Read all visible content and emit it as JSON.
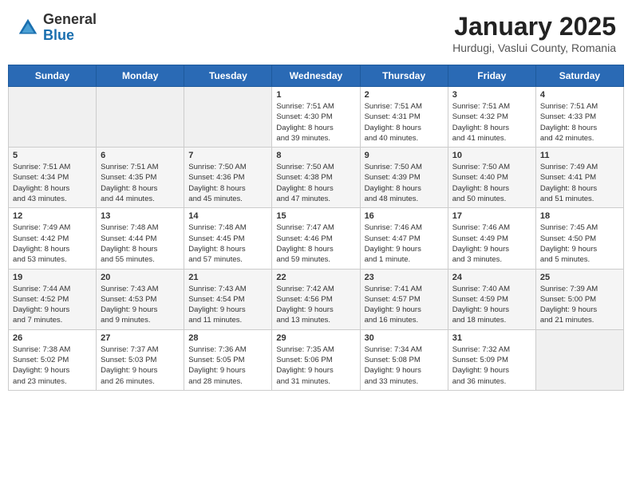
{
  "header": {
    "logo_general": "General",
    "logo_blue": "Blue",
    "title": "January 2025",
    "subtitle": "Hurdugi, Vaslui County, Romania"
  },
  "days_of_week": [
    "Sunday",
    "Monday",
    "Tuesday",
    "Wednesday",
    "Thursday",
    "Friday",
    "Saturday"
  ],
  "weeks": [
    [
      {
        "day": "",
        "info": ""
      },
      {
        "day": "",
        "info": ""
      },
      {
        "day": "",
        "info": ""
      },
      {
        "day": "1",
        "info": "Sunrise: 7:51 AM\nSunset: 4:30 PM\nDaylight: 8 hours\nand 39 minutes."
      },
      {
        "day": "2",
        "info": "Sunrise: 7:51 AM\nSunset: 4:31 PM\nDaylight: 8 hours\nand 40 minutes."
      },
      {
        "day": "3",
        "info": "Sunrise: 7:51 AM\nSunset: 4:32 PM\nDaylight: 8 hours\nand 41 minutes."
      },
      {
        "day": "4",
        "info": "Sunrise: 7:51 AM\nSunset: 4:33 PM\nDaylight: 8 hours\nand 42 minutes."
      }
    ],
    [
      {
        "day": "5",
        "info": "Sunrise: 7:51 AM\nSunset: 4:34 PM\nDaylight: 8 hours\nand 43 minutes."
      },
      {
        "day": "6",
        "info": "Sunrise: 7:51 AM\nSunset: 4:35 PM\nDaylight: 8 hours\nand 44 minutes."
      },
      {
        "day": "7",
        "info": "Sunrise: 7:50 AM\nSunset: 4:36 PM\nDaylight: 8 hours\nand 45 minutes."
      },
      {
        "day": "8",
        "info": "Sunrise: 7:50 AM\nSunset: 4:38 PM\nDaylight: 8 hours\nand 47 minutes."
      },
      {
        "day": "9",
        "info": "Sunrise: 7:50 AM\nSunset: 4:39 PM\nDaylight: 8 hours\nand 48 minutes."
      },
      {
        "day": "10",
        "info": "Sunrise: 7:50 AM\nSunset: 4:40 PM\nDaylight: 8 hours\nand 50 minutes."
      },
      {
        "day": "11",
        "info": "Sunrise: 7:49 AM\nSunset: 4:41 PM\nDaylight: 8 hours\nand 51 minutes."
      }
    ],
    [
      {
        "day": "12",
        "info": "Sunrise: 7:49 AM\nSunset: 4:42 PM\nDaylight: 8 hours\nand 53 minutes."
      },
      {
        "day": "13",
        "info": "Sunrise: 7:48 AM\nSunset: 4:44 PM\nDaylight: 8 hours\nand 55 minutes."
      },
      {
        "day": "14",
        "info": "Sunrise: 7:48 AM\nSunset: 4:45 PM\nDaylight: 8 hours\nand 57 minutes."
      },
      {
        "day": "15",
        "info": "Sunrise: 7:47 AM\nSunset: 4:46 PM\nDaylight: 8 hours\nand 59 minutes."
      },
      {
        "day": "16",
        "info": "Sunrise: 7:46 AM\nSunset: 4:47 PM\nDaylight: 9 hours\nand 1 minute."
      },
      {
        "day": "17",
        "info": "Sunrise: 7:46 AM\nSunset: 4:49 PM\nDaylight: 9 hours\nand 3 minutes."
      },
      {
        "day": "18",
        "info": "Sunrise: 7:45 AM\nSunset: 4:50 PM\nDaylight: 9 hours\nand 5 minutes."
      }
    ],
    [
      {
        "day": "19",
        "info": "Sunrise: 7:44 AM\nSunset: 4:52 PM\nDaylight: 9 hours\nand 7 minutes."
      },
      {
        "day": "20",
        "info": "Sunrise: 7:43 AM\nSunset: 4:53 PM\nDaylight: 9 hours\nand 9 minutes."
      },
      {
        "day": "21",
        "info": "Sunrise: 7:43 AM\nSunset: 4:54 PM\nDaylight: 9 hours\nand 11 minutes."
      },
      {
        "day": "22",
        "info": "Sunrise: 7:42 AM\nSunset: 4:56 PM\nDaylight: 9 hours\nand 13 minutes."
      },
      {
        "day": "23",
        "info": "Sunrise: 7:41 AM\nSunset: 4:57 PM\nDaylight: 9 hours\nand 16 minutes."
      },
      {
        "day": "24",
        "info": "Sunrise: 7:40 AM\nSunset: 4:59 PM\nDaylight: 9 hours\nand 18 minutes."
      },
      {
        "day": "25",
        "info": "Sunrise: 7:39 AM\nSunset: 5:00 PM\nDaylight: 9 hours\nand 21 minutes."
      }
    ],
    [
      {
        "day": "26",
        "info": "Sunrise: 7:38 AM\nSunset: 5:02 PM\nDaylight: 9 hours\nand 23 minutes."
      },
      {
        "day": "27",
        "info": "Sunrise: 7:37 AM\nSunset: 5:03 PM\nDaylight: 9 hours\nand 26 minutes."
      },
      {
        "day": "28",
        "info": "Sunrise: 7:36 AM\nSunset: 5:05 PM\nDaylight: 9 hours\nand 28 minutes."
      },
      {
        "day": "29",
        "info": "Sunrise: 7:35 AM\nSunset: 5:06 PM\nDaylight: 9 hours\nand 31 minutes."
      },
      {
        "day": "30",
        "info": "Sunrise: 7:34 AM\nSunset: 5:08 PM\nDaylight: 9 hours\nand 33 minutes."
      },
      {
        "day": "31",
        "info": "Sunrise: 7:32 AM\nSunset: 5:09 PM\nDaylight: 9 hours\nand 36 minutes."
      },
      {
        "day": "",
        "info": ""
      }
    ]
  ]
}
